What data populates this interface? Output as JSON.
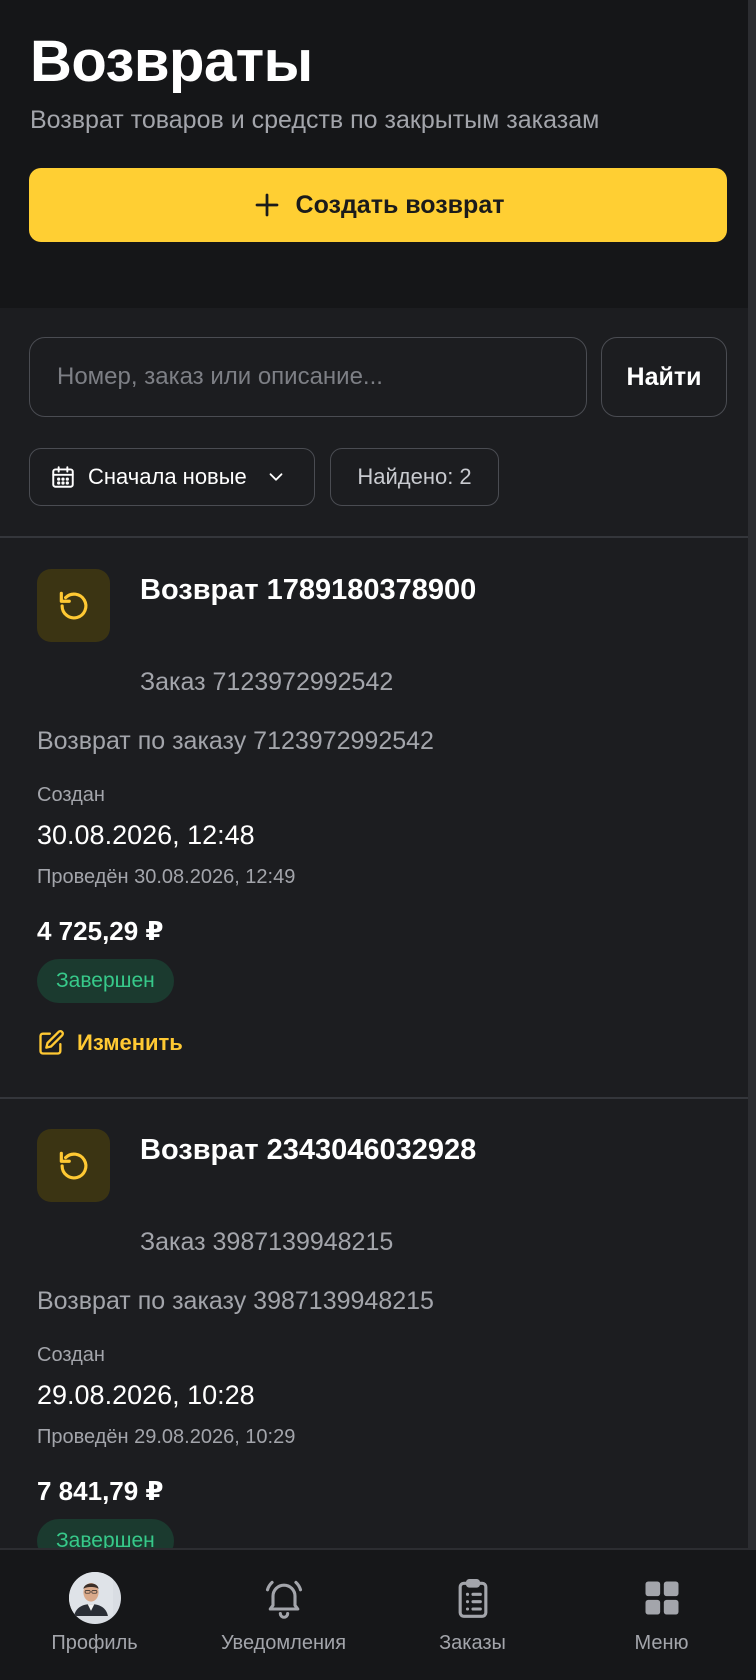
{
  "header": {
    "title": "Возвраты",
    "subtitle": "Возврат товаров и средств по закрытым заказам",
    "create_label": "Создать возврат"
  },
  "search": {
    "placeholder": "Номер, заказ или описание...",
    "value": "",
    "button_label": "Найти"
  },
  "filters": {
    "sort_label": "Сначала новые",
    "found_label": "Найдено: 2"
  },
  "returns": [
    {
      "title": "Возврат 1789180378900",
      "order": "Заказ 7123972992542",
      "description": "Возврат по заказу 7123972992542",
      "created_label": "Создан",
      "created_value": "30.08.2026, 12:48",
      "processed": "Проведён 30.08.2026, 12:49",
      "amount": "4 725,29 ₽",
      "status": "Завершен",
      "edit_label": "Изменить"
    },
    {
      "title": "Возврат 2343046032928",
      "order": "Заказ 3987139948215",
      "description": "Возврат по заказу 3987139948215",
      "created_label": "Создан",
      "created_value": "29.08.2026, 10:28",
      "processed": "Проведён 29.08.2026, 10:29",
      "amount": "7 841,79 ₽",
      "status": "Завершен"
    }
  ],
  "nav": {
    "items": [
      {
        "label": "Профиль",
        "icon": "avatar"
      },
      {
        "label": "Уведомления",
        "icon": "bell-icon"
      },
      {
        "label": "Заказы",
        "icon": "clipboard-icon"
      },
      {
        "label": "Меню",
        "icon": "grid-icon"
      }
    ]
  },
  "colors": {
    "accent": "#ffcf33",
    "background": "#1c1d20",
    "status_success": "#37c98a"
  }
}
